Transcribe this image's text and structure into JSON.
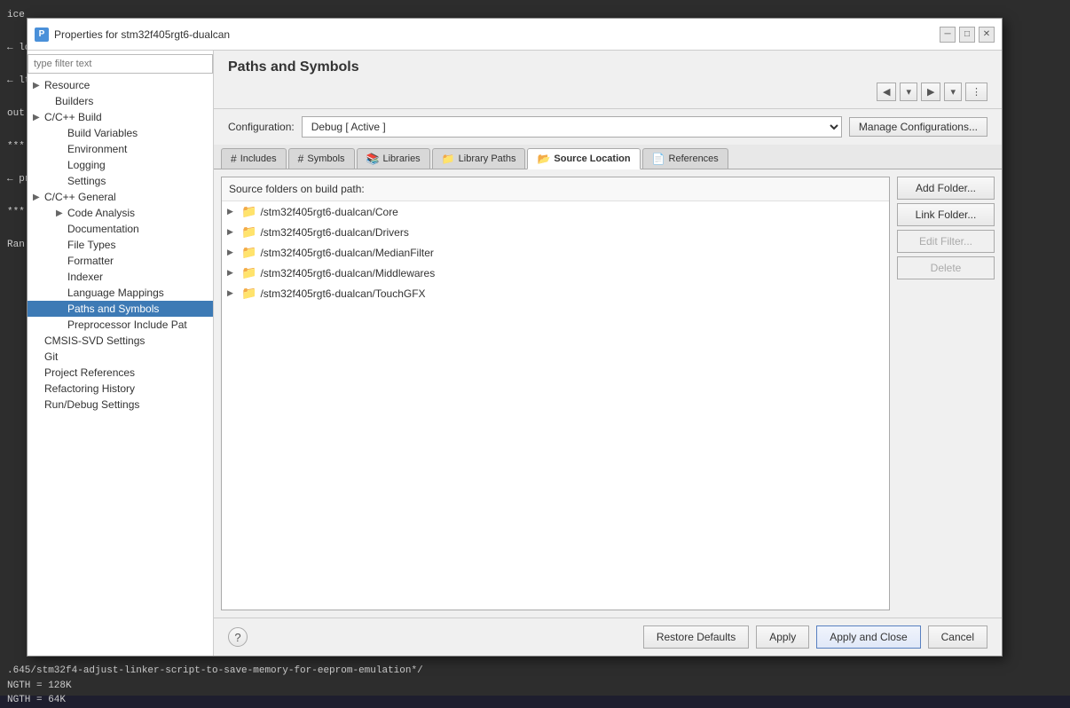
{
  "editor": {
    "lines": [
      "ice",
      "",
      "← lo",
      "",
      "← lter",
      "",
      "out",
      "",
      "***",
      "",
      "← pr",
      "",
      "***",
      "",
      "Ran"
    ]
  },
  "statusBar": {
    "line1": ".645/stm32f4-adjust-linker-script-to-save-memory-for-eeprom-emulation*/",
    "line2": "NGTH = 128K",
    "line3": "NGTH = 64K"
  },
  "dialog": {
    "title": "Properties for stm32f405rgt6-dualcan",
    "titleIcon": "P",
    "titleButtons": [
      "─",
      "□",
      "✕"
    ]
  },
  "sidebar": {
    "filterPlaceholder": "type filter text",
    "items": [
      {
        "id": "resource",
        "label": "Resource",
        "indent": 0,
        "hasArrow": true,
        "selected": false
      },
      {
        "id": "builders",
        "label": "Builders",
        "indent": 1,
        "hasArrow": false,
        "selected": false
      },
      {
        "id": "c-cpp-build",
        "label": "C/C++ Build",
        "indent": 0,
        "hasArrow": true,
        "selected": false
      },
      {
        "id": "build-variables",
        "label": "Build Variables",
        "indent": 2,
        "hasArrow": false,
        "selected": false
      },
      {
        "id": "environment",
        "label": "Environment",
        "indent": 2,
        "hasArrow": false,
        "selected": false
      },
      {
        "id": "logging",
        "label": "Logging",
        "indent": 2,
        "hasArrow": false,
        "selected": false
      },
      {
        "id": "settings",
        "label": "Settings",
        "indent": 2,
        "hasArrow": false,
        "selected": false
      },
      {
        "id": "c-cpp-general",
        "label": "C/C++ General",
        "indent": 0,
        "hasArrow": true,
        "selected": false
      },
      {
        "id": "code-analysis",
        "label": "Code Analysis",
        "indent": 2,
        "hasArrow": true,
        "selected": false
      },
      {
        "id": "documentation",
        "label": "Documentation",
        "indent": 2,
        "hasArrow": false,
        "selected": false
      },
      {
        "id": "file-types",
        "label": "File Types",
        "indent": 2,
        "hasArrow": false,
        "selected": false
      },
      {
        "id": "formatter",
        "label": "Formatter",
        "indent": 2,
        "hasArrow": false,
        "selected": false
      },
      {
        "id": "indexer",
        "label": "Indexer",
        "indent": 2,
        "hasArrow": false,
        "selected": false
      },
      {
        "id": "language-mappings",
        "label": "Language Mappings",
        "indent": 2,
        "hasArrow": false,
        "selected": false
      },
      {
        "id": "paths-and-symbols",
        "label": "Paths and Symbols",
        "indent": 2,
        "hasArrow": false,
        "selected": true
      },
      {
        "id": "preprocessor-include",
        "label": "Preprocessor Include Pat",
        "indent": 2,
        "hasArrow": false,
        "selected": false
      },
      {
        "id": "cmsis-svd",
        "label": "CMSIS-SVD Settings",
        "indent": 0,
        "hasArrow": false,
        "selected": false
      },
      {
        "id": "git",
        "label": "Git",
        "indent": 0,
        "hasArrow": false,
        "selected": false
      },
      {
        "id": "project-references",
        "label": "Project References",
        "indent": 0,
        "hasArrow": false,
        "selected": false
      },
      {
        "id": "refactoring-history",
        "label": "Refactoring History",
        "indent": 0,
        "hasArrow": false,
        "selected": false
      },
      {
        "id": "run-debug-settings",
        "label": "Run/Debug Settings",
        "indent": 0,
        "hasArrow": false,
        "selected": false
      }
    ]
  },
  "panel": {
    "title": "Paths and Symbols",
    "configuration": {
      "label": "Configuration:",
      "value": "Debug  [ Active ]",
      "manageButton": "Manage Configurations..."
    },
    "tabs": [
      {
        "id": "includes",
        "label": "Includes",
        "icon": "#",
        "active": false
      },
      {
        "id": "symbols",
        "label": "Symbols",
        "icon": "#",
        "active": false
      },
      {
        "id": "libraries",
        "label": "Libraries",
        "icon": "📚",
        "active": false
      },
      {
        "id": "library-paths",
        "label": "Library Paths",
        "icon": "📁",
        "active": false
      },
      {
        "id": "source-location",
        "label": "Source Location",
        "icon": "📂",
        "active": true
      },
      {
        "id": "references",
        "label": "References",
        "icon": "📄",
        "active": false
      }
    ],
    "sourceFoldersHeader": "Source folders on build path:",
    "folders": [
      {
        "path": "/stm32f405rgt6-dualcan/Core"
      },
      {
        "path": "/stm32f405rgt6-dualcan/Drivers"
      },
      {
        "path": "/stm32f405rgt6-dualcan/MedianFilter"
      },
      {
        "path": "/stm32f405rgt6-dualcan/Middlewares"
      },
      {
        "path": "/stm32f405rgt6-dualcan/TouchGFX"
      }
    ],
    "buttons": {
      "addFolder": "Add Folder...",
      "linkFolder": "Link Folder...",
      "editFilter": "Edit Filter...",
      "delete": "Delete"
    },
    "footer": {
      "help": "?",
      "restoreDefaults": "Restore Defaults",
      "apply": "Apply",
      "applyAndClose": "Apply and Close",
      "cancel": "Cancel"
    }
  }
}
